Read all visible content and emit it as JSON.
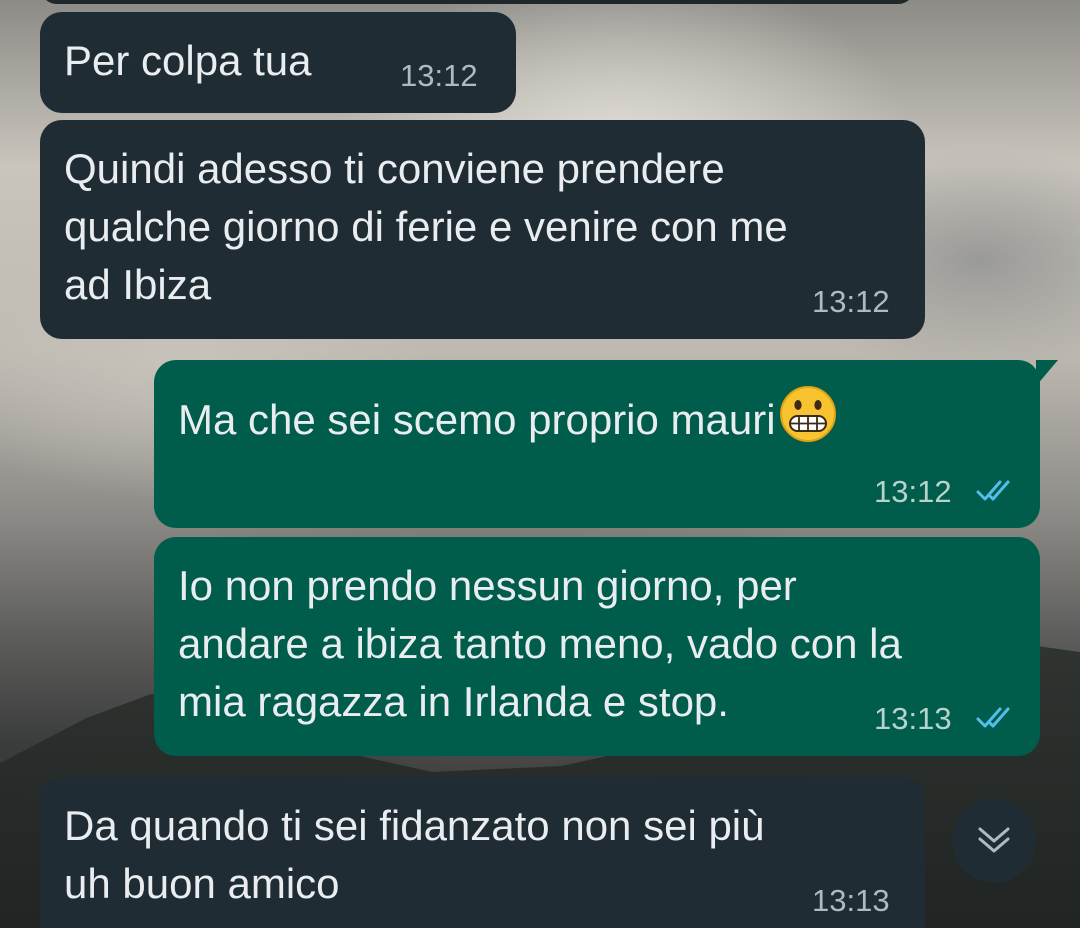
{
  "messages": [
    {
      "direction": "incoming",
      "text": "Per colpa tua",
      "time": "13:12"
    },
    {
      "direction": "incoming",
      "text": "Quindi adesso ti conviene prendere\nqualche giorno di ferie e venire con me\nad Ibiza",
      "time": "13:12"
    },
    {
      "direction": "outgoing",
      "text": "Ma che sei scemo proprio mauri",
      "emoji": "grimacing-face",
      "time": "13:12",
      "status": "read-double-check"
    },
    {
      "direction": "outgoing",
      "text": "Io non prendo nessun giorno,  per\nandare a ibiza tanto meno, vado con la\nmia ragazza in Irlanda e stop.",
      "time": "13:13",
      "status": "read-double-check"
    },
    {
      "direction": "incoming",
      "text": "Da quando ti sei fidanzato non sei più\nuh buon amico",
      "time": "13:13"
    }
  ],
  "controls": {
    "scroll_down_icon": "chevron-double-down-icon"
  },
  "colors": {
    "incoming_bubble": "#1f2c33",
    "outgoing_bubble": "#005c4b",
    "text": "#e9edef",
    "read_ticks": "#53bdeb"
  }
}
